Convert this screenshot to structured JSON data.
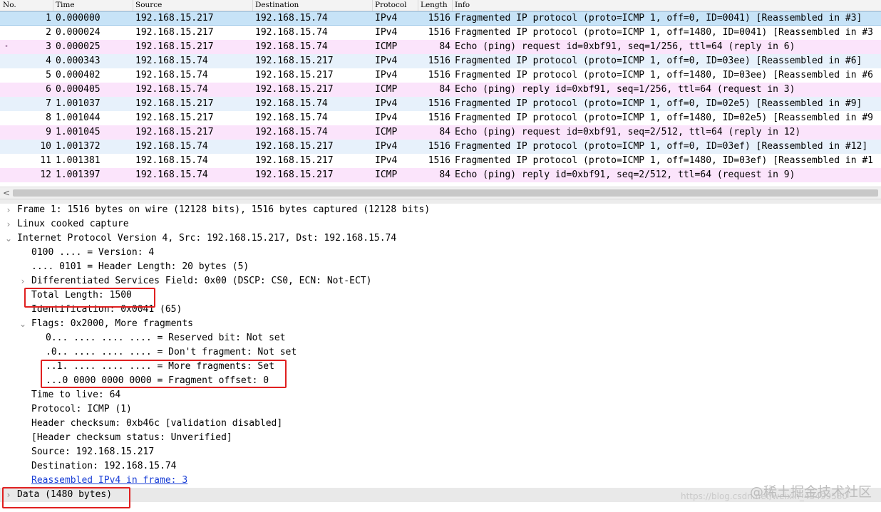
{
  "packet_list": {
    "columns": {
      "no": "No.",
      "time": "Time",
      "source": "Source",
      "destination": "Destination",
      "protocol": "Protocol",
      "length": "Length",
      "info": "Info"
    },
    "rows": [
      {
        "no": "1",
        "time": "0.000000",
        "src": "192.168.15.217",
        "dst": "192.168.15.74",
        "proto": "IPv4",
        "len": "1516",
        "info": "Fragmented IP protocol (proto=ICMP 1, off=0, ID=0041) [Reassembled in #3]"
      },
      {
        "no": "2",
        "time": "0.000024",
        "src": "192.168.15.217",
        "dst": "192.168.15.74",
        "proto": "IPv4",
        "len": "1516",
        "info": "Fragmented IP protocol (proto=ICMP 1, off=1480, ID=0041) [Reassembled in #3"
      },
      {
        "no": "3",
        "time": "0.000025",
        "src": "192.168.15.217",
        "dst": "192.168.15.74",
        "proto": "ICMP",
        "len": "84",
        "info": "Echo (ping) request  id=0xbf91, seq=1/256, ttl=64 (reply in 6)"
      },
      {
        "no": "4",
        "time": "0.000343",
        "src": "192.168.15.74",
        "dst": "192.168.15.217",
        "proto": "IPv4",
        "len": "1516",
        "info": "Fragmented IP protocol (proto=ICMP 1, off=0, ID=03ee) [Reassembled in #6]"
      },
      {
        "no": "5",
        "time": "0.000402",
        "src": "192.168.15.74",
        "dst": "192.168.15.217",
        "proto": "IPv4",
        "len": "1516",
        "info": "Fragmented IP protocol (proto=ICMP 1, off=1480, ID=03ee) [Reassembled in #6"
      },
      {
        "no": "6",
        "time": "0.000405",
        "src": "192.168.15.74",
        "dst": "192.168.15.217",
        "proto": "ICMP",
        "len": "84",
        "info": "Echo (ping) reply    id=0xbf91, seq=1/256, ttl=64 (request in 3)"
      },
      {
        "no": "7",
        "time": "1.001037",
        "src": "192.168.15.217",
        "dst": "192.168.15.74",
        "proto": "IPv4",
        "len": "1516",
        "info": "Fragmented IP protocol (proto=ICMP 1, off=0, ID=02e5) [Reassembled in #9]"
      },
      {
        "no": "8",
        "time": "1.001044",
        "src": "192.168.15.217",
        "dst": "192.168.15.74",
        "proto": "IPv4",
        "len": "1516",
        "info": "Fragmented IP protocol (proto=ICMP 1, off=1480, ID=02e5) [Reassembled in #9"
      },
      {
        "no": "9",
        "time": "1.001045",
        "src": "192.168.15.217",
        "dst": "192.168.15.74",
        "proto": "ICMP",
        "len": "84",
        "info": "Echo (ping) request  id=0xbf91, seq=2/512, ttl=64 (reply in 12)"
      },
      {
        "no": "10",
        "time": "1.001372",
        "src": "192.168.15.74",
        "dst": "192.168.15.217",
        "proto": "IPv4",
        "len": "1516",
        "info": "Fragmented IP protocol (proto=ICMP 1, off=0, ID=03ef) [Reassembled in #12]"
      },
      {
        "no": "11",
        "time": "1.001381",
        "src": "192.168.15.74",
        "dst": "192.168.15.217",
        "proto": "IPv4",
        "len": "1516",
        "info": "Fragmented IP protocol (proto=ICMP 1, off=1480, ID=03ef) [Reassembled in #1"
      },
      {
        "no": "12",
        "time": "1.001397",
        "src": "192.168.15.74",
        "dst": "192.168.15.217",
        "proto": "ICMP",
        "len": "84",
        "info": "Echo (ping) reply    id=0xbf91, seq=2/512, ttl=64 (request in 9)"
      }
    ]
  },
  "details": {
    "frame": "Frame 1: 1516 bytes on wire (12128 bits), 1516 bytes captured (12128 bits)",
    "linux_cooked": "Linux cooked capture",
    "ip": "Internet Protocol Version 4, Src: 192.168.15.217, Dst: 192.168.15.74",
    "version": "0100 .... = Version: 4",
    "header_length": ".... 0101 = Header Length: 20 bytes (5)",
    "dsf": "Differentiated Services Field: 0x00 (DSCP: CS0, ECN: Not-ECT)",
    "total_length": "Total Length: 1500",
    "identification": "Identification: 0x0041 (65)",
    "flags": "Flags: 0x2000, More fragments",
    "reserved_bit": "0... .... .... .... = Reserved bit: Not set",
    "dont_fragment": ".0.. .... .... .... = Don't fragment: Not set",
    "more_fragments": "..1. .... .... .... = More fragments: Set",
    "fragment_offset": "...0 0000 0000 0000 = Fragment offset: 0",
    "ttl": "Time to live: 64",
    "protocol": "Protocol: ICMP (1)",
    "checksum": "Header checksum: 0xb46c [validation disabled]",
    "checksum_status": "[Header checksum status: Unverified]",
    "source": "Source: 192.168.15.217",
    "destination": "Destination: 192.168.15.74",
    "reassembled": "Reassembled IPv4 in frame: 3",
    "data": "Data (1480 bytes)"
  },
  "icons": {
    "collapsed": "›",
    "expanded": "⌄",
    "scroll_left": "<"
  },
  "watermark": {
    "url": "https://blog.csdn.net/weixin_43499580",
    "logo": "@稀土掘金技术社区"
  }
}
